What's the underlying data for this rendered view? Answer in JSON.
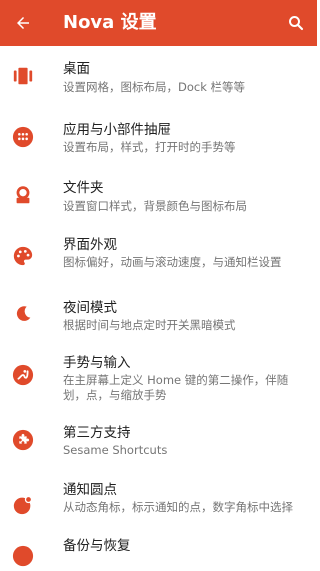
{
  "appbar": {
    "title": "Nova 设置",
    "color": "#e04a2b",
    "back_icon": "arrow-left-icon",
    "search_icon": "search-icon"
  },
  "accent_color": "#e04a2b",
  "items": [
    {
      "title": "桌面",
      "subtitle": "设置网格，图标布局，Dock 栏等等",
      "icon": "desktop-icon"
    },
    {
      "title": "应用与小部件抽屉",
      "subtitle": "设置布局，样式，打开时的手势等",
      "icon": "app-drawer-icon"
    },
    {
      "title": "文件夹",
      "subtitle": "设置窗口样式，背景颜色与图标布局",
      "icon": "folder-icon"
    },
    {
      "title": "界面外观",
      "subtitle": "图标偏好，动画与滚动速度，与通知栏设置",
      "icon": "palette-icon"
    },
    {
      "title": "夜间模式",
      "subtitle": "根据时间与地点定时开关黑暗模式",
      "icon": "moon-icon"
    },
    {
      "title": "手势与输入",
      "subtitle": "在主屏幕上定义 Home 键的第二操作，伴随划，点，与缩放手势",
      "icon": "gesture-icon"
    },
    {
      "title": "第三方支持",
      "subtitle": "Sesame Shortcuts",
      "icon": "puzzle-icon"
    },
    {
      "title": "通知圆点",
      "subtitle": "从动态角标，标示通知的点，数字角标中选择",
      "icon": "notification-dot-icon"
    },
    {
      "title": "备份与恢复",
      "subtitle": "",
      "icon": "backup-icon"
    }
  ]
}
